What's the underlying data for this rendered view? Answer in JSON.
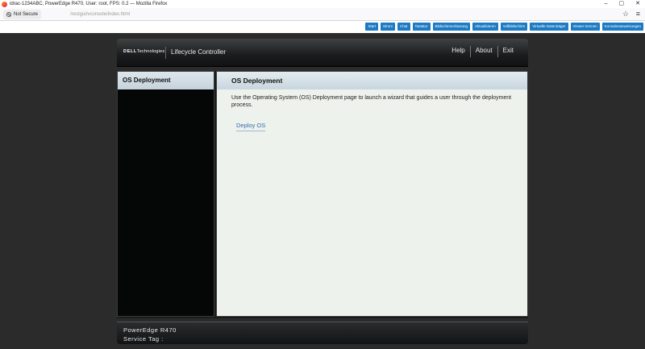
{
  "browser": {
    "window_title": "idrac-1234ABC, PowerEdge R470, User: root, FPS: 0.2 — Mozilla Firefox",
    "window_controls": [
      "–",
      "▢",
      "✕"
    ],
    "security_label": "Not Secure",
    "url": "/restgui/vconsole/index.html",
    "icons": {
      "security": "not-secure-icon",
      "bookmark": "star-icon",
      "menu": "hamburger-menu-icon"
    }
  },
  "toolbar": {
    "buttons": [
      "Start",
      "Strom",
      "Chat",
      "Tastatur",
      "Bildschirmerfassung",
      "Aktualisieren",
      "Vollbildschirm",
      "Virtuelle Datenträger",
      "Viewer trennen",
      "Konsolenanweisungen"
    ],
    "accent": "#1c7bc4"
  },
  "lc": {
    "logo_brand": "DELL",
    "logo_suffix": "Technologies",
    "title": "Lifecycle Controller",
    "header_links": [
      "Help",
      "About",
      "Exit"
    ],
    "left_nav_item": "OS Deployment",
    "page_title": "OS Deployment",
    "description": "Use the Operating System (OS) Deployment page to launch a wizard that guides a user through the deployment process.",
    "deploy_link": "Deploy OS",
    "footer_model": "PowerEdge R470",
    "footer_service_tag": "Service Tag :"
  }
}
